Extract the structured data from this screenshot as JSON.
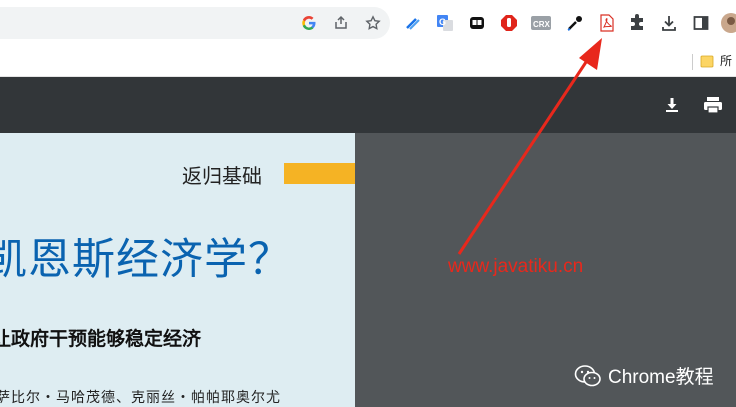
{
  "browser": {
    "bookmark_folder_label": "所",
    "extensions": [
      "pen-tool-icon",
      "google-translate-icon",
      "tab-manager-icon",
      "adblock-icon",
      "crx-icon",
      "color-picker-icon",
      "pdf-viewer-icon",
      "extensions-puzzle-icon",
      "download-icon",
      "side-panel-icon",
      "profile-avatar"
    ],
    "crx_label": "CRX",
    "translate_label": "G"
  },
  "pdf": {
    "toolbar_icons": [
      "download-icon",
      "print-icon"
    ],
    "page": {
      "section_title": "返归基础",
      "main_title": "凯恩斯经济学？",
      "subtitle": "让政府干预能够稳定经济",
      "authors": "萨比尔・马哈茂德、克丽丝・帕帕耶奥尔尤"
    }
  },
  "annotation": {
    "watermark": "www.javatiku.cn",
    "arrow_color": "#e8281c",
    "wechat_label": "Chrome教程"
  },
  "colors": {
    "orange": "#f5b324",
    "title_blue": "#0a63b0",
    "page_bg": "#deedf2",
    "viewer_bg": "#525659"
  }
}
